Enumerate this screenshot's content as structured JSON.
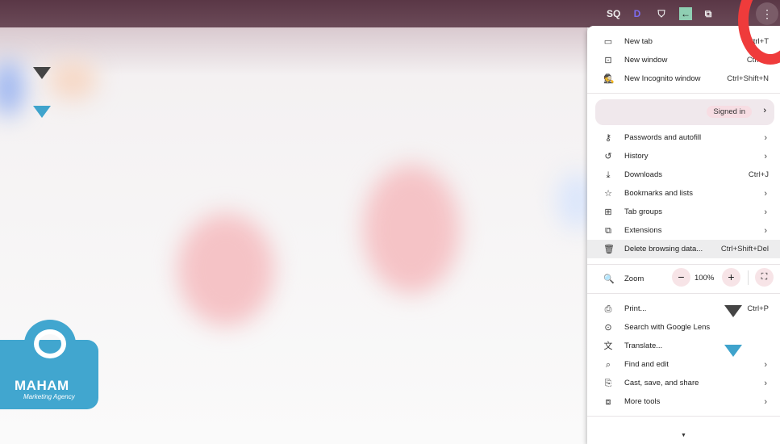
{
  "toolbar": {
    "extensions": [
      "sq-icon",
      "d-extension-icon",
      "shield-extension-icon",
      "back-arrow-extension-icon",
      "puzzle-icon"
    ],
    "ext_labels": [
      "SQ",
      "D"
    ],
    "menu_button": "⋮"
  },
  "menu": {
    "items_top": [
      {
        "label": "New tab",
        "shortcut": "Ctrl+T",
        "icon": "new-tab-icon"
      },
      {
        "label": "New window",
        "shortcut": "Ctrl+N",
        "icon": "new-window-icon"
      },
      {
        "label": "New Incognito window",
        "shortcut": "Ctrl+Shift+N",
        "icon": "incognito-icon"
      }
    ],
    "signed_in": "Signed in",
    "items_mid": [
      {
        "label": "Passwords and autofill",
        "icon": "key-icon"
      },
      {
        "label": "History",
        "icon": "history-icon"
      },
      {
        "label": "Downloads",
        "shortcut": "Ctrl+J",
        "icon": "download-icon"
      },
      {
        "label": "Bookmarks and lists",
        "icon": "star-icon"
      },
      {
        "label": "Tab groups",
        "icon": "tab-groups-icon"
      },
      {
        "label": "Extensions",
        "icon": "puzzle-icon"
      },
      {
        "label": "Delete browsing data...",
        "shortcut": "Ctrl+Shift+Del",
        "icon": "trash-icon"
      }
    ],
    "zoom": {
      "label": "Zoom",
      "value": "100%",
      "minus": "−",
      "plus": "+"
    },
    "items_bottom": [
      {
        "label": "Print...",
        "shortcut": "Ctrl+P",
        "icon": "print-icon"
      },
      {
        "label": "Search with Google Lens",
        "icon": "lens-icon"
      },
      {
        "label": "Translate...",
        "icon": "translate-icon"
      },
      {
        "label": "Find and edit",
        "icon": "find-icon"
      },
      {
        "label": "Cast, save, and share",
        "icon": "cast-icon"
      },
      {
        "label": "More tools",
        "icon": "toolbox-icon"
      }
    ]
  },
  "logo": {
    "name": "MAHAM",
    "tagline": "Marketing Agency"
  },
  "colors": {
    "accent_red": "#ef3b3b",
    "logo_blue": "#41a6cf",
    "topbar": "#5a3746"
  }
}
